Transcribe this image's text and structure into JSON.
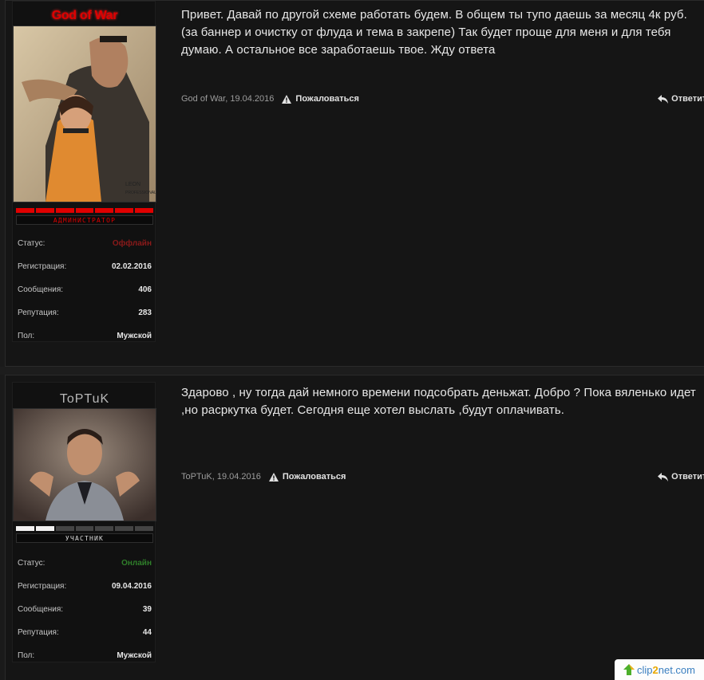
{
  "posts": [
    {
      "username": "God of War",
      "rank_label": "АДМИНИСТРАТОР",
      "rank_segments_filled": 7,
      "rank_segments_total": 7,
      "rank_color": "#e00000",
      "stats": [
        {
          "label": "Статус:",
          "value": "Оффлайн",
          "color": "#8b1a1a"
        },
        {
          "label": "Регистрация:",
          "value": "02.02.2016"
        },
        {
          "label": "Сообщения:",
          "value": "406"
        },
        {
          "label": "Репутация:",
          "value": "283"
        },
        {
          "label": "Пол:",
          "value": "Мужской"
        }
      ],
      "message": "Привет. Давай по другой схеме работать будем. В общем ты тупо даешь за месяц 4к руб. (за баннер и очистку от флуда и тема в закрепе) Так будет проще для меня и для тебя думаю. А остальное все заработаешь твое. Жду ответа",
      "author_date": "God of War, 19.04.2016",
      "report_label": "Пожаловаться",
      "reply_label": "Ответить"
    },
    {
      "username": "ToPTuK",
      "rank_label": "УЧАСТНИК",
      "rank_segments_filled": 2,
      "rank_segments_total": 7,
      "rank_color": "#f2f2f2",
      "stats": [
        {
          "label": "Статус:",
          "value": "Онлайн",
          "color": "#2f7f2a"
        },
        {
          "label": "Регистрация:",
          "value": "09.04.2016"
        },
        {
          "label": "Сообщения:",
          "value": "39"
        },
        {
          "label": "Репутация:",
          "value": "44"
        },
        {
          "label": "Пол:",
          "value": "Мужской"
        }
      ],
      "message": "Здарово , ну тогда дай немного времени подсобрать деньжат. Добро ? Пока вяленько идет ,но расркутка будет. Сегодня еще хотел выслать ,будут оплачивать.",
      "author_date": "ToPTuK, 19.04.2016",
      "report_label": "Пожаловаться",
      "reply_label": "Ответить"
    }
  ],
  "watermark": {
    "text_pre": "clip",
    "text_digit": "2",
    "text_post": "net.com"
  }
}
